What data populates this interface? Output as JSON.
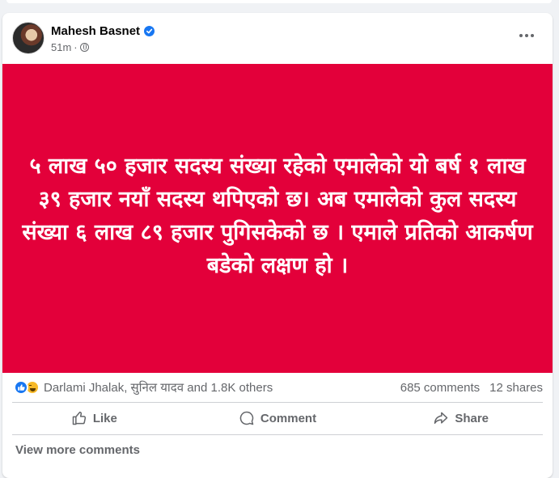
{
  "post": {
    "author": "Mahesh Basnet",
    "time": "51m",
    "separator": "·",
    "banner_color": "#e3003a",
    "banner_text": "५ लाख ५० हजार सदस्य संख्या रहेको एमालेको यो बर्ष १ लाख ३९ हजार नयाँ सदस्य थपिएको छ। अब एमालेको कुल सदस्य संख्या ६ लाख ८९ हजार पुगिसकेको छ । एमाले प्रतिको आकर्षण बडेको लक्षण हो ।"
  },
  "reactions": {
    "icons": [
      "like-reaction-icon",
      "haha-reaction-icon"
    ],
    "summary": "Darlami Jhalak, सुनिल यादव and 1.8K others",
    "comments": "685 comments",
    "shares": "12 shares"
  },
  "actions": {
    "like": "Like",
    "comment": "Comment",
    "share": "Share"
  },
  "comments": {
    "view_more": "View more comments"
  },
  "colors": {
    "accent": "#1877f2",
    "muted_text": "#65676b"
  }
}
